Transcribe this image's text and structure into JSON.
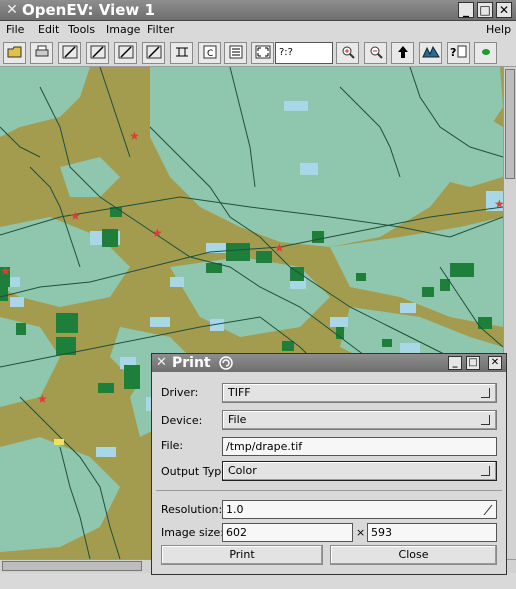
{
  "window": {
    "title": "OpenEV: View 1",
    "close_icon": "✕",
    "min_label": "_",
    "max_label": "□",
    "x_label": "✕"
  },
  "menu": {
    "items": [
      "File",
      "Edit",
      "Tools",
      "Image",
      "Filter"
    ],
    "help": "Help"
  },
  "toolbar": {
    "coord_value": "?:?",
    "icons": [
      "open-icon",
      "print-icon",
      "draw-line-icon",
      "draw-polyline-icon",
      "draw-polygon-icon",
      "draw-area-icon",
      "roi-icon",
      "copy-icon",
      "list-icon",
      "fit-icon"
    ],
    "right_icons": [
      "zoom-in-icon",
      "zoom-out-icon",
      "north-arrow-icon",
      "3d-view-icon",
      "help-doc-icon",
      "green-dot-icon"
    ]
  },
  "colors": {
    "map_land": "#a39c4e",
    "map_vegetation": "#8fc7ae",
    "map_water": "#a8d8e8",
    "map_forest": "#1e7f3a",
    "map_river": "#1e4f3a",
    "marker": "#e23b3b"
  },
  "print_dialog": {
    "title": "Print",
    "driver_label": "Driver:",
    "driver_value": "TIFF",
    "device_label": "Device:",
    "device_value": "File",
    "file_label": "File:",
    "file_value": "/tmp/drape.tif",
    "output_type_label": "Output Type:",
    "output_type_value": "Color",
    "resolution_label": "Resolution:",
    "resolution_value": "1.0",
    "image_size_label": "Image size:",
    "width_value": "602",
    "times": "×",
    "height_value": "593",
    "print_label": "Print",
    "close_label": "Close"
  }
}
